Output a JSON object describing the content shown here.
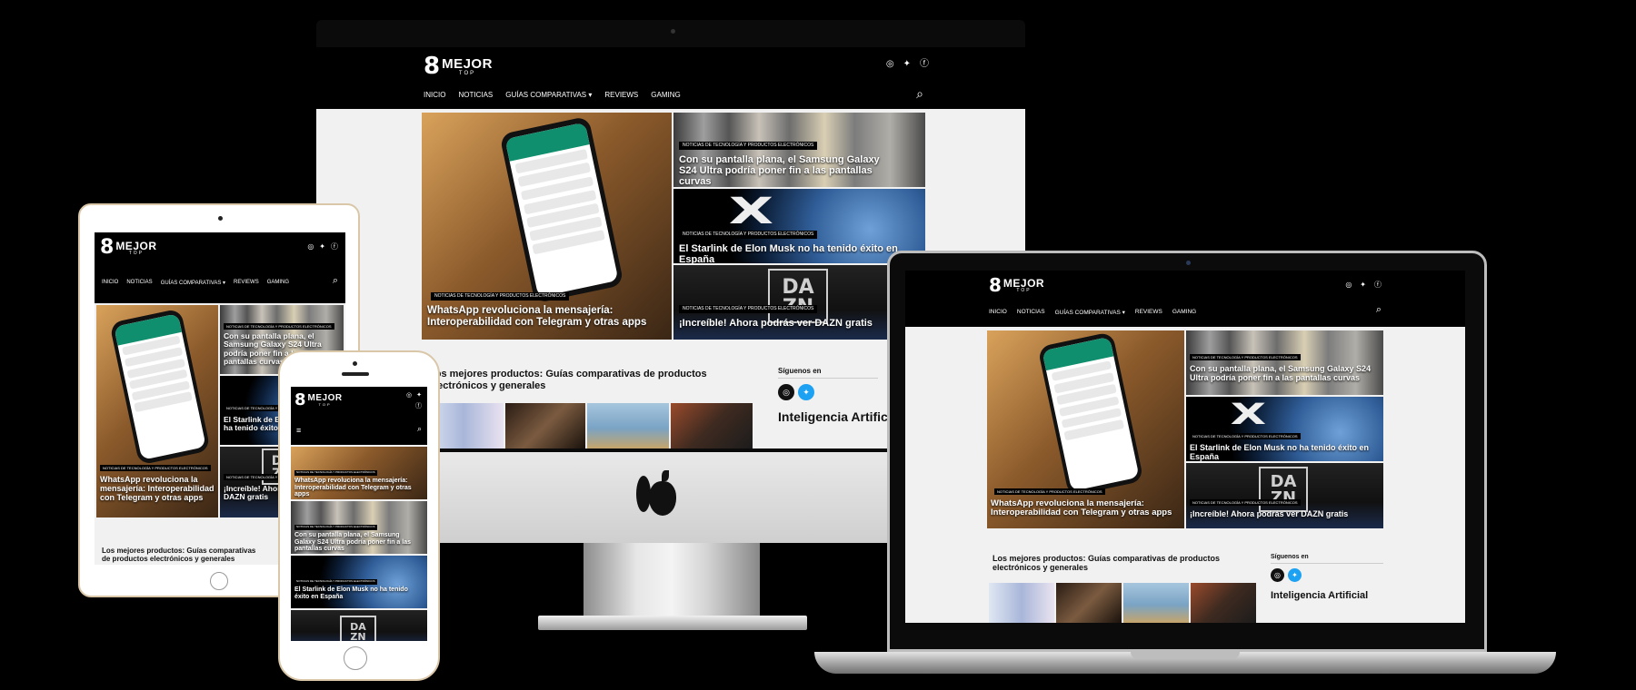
{
  "site": {
    "logo_mark": "8",
    "logo_word": "MEJOR",
    "logo_sub": "TOP",
    "nav": [
      "INICIO",
      "NOTICIAS",
      "GUÍAS COMPARATIVAS ▾",
      "REVIEWS",
      "GAMING"
    ],
    "social_icons": [
      "instagram-icon",
      "twitter-icon",
      "facebook-icon"
    ],
    "social_glyphs": [
      "◎",
      "✦",
      "ⓕ"
    ],
    "search_glyph": "⌕",
    "menu_glyph": "≡",
    "category": "NOTICIAS DE TECNOLOGÍA Y PRODUCTOS ELECTRÓNICOS",
    "articles": [
      {
        "title": "WhatsApp revoluciona la mensajería: Interoperabilidad con Telegram y otras apps"
      },
      {
        "title": "Con su pantalla plana, el Samsung Galaxy S24 Ultra podría poner fin a las pantallas curvas"
      },
      {
        "title": "El Starlink de Elon Musk no ha tenido éxito en España"
      },
      {
        "title": "¡Increíble! Ahora podrás ver DAZN gratis"
      }
    ],
    "section_title": "Los mejores productos: Guías comparativas de productos electrónicos y generales",
    "follow_label": "Síguenos en",
    "widget_title": "Inteligencia Artificial",
    "dazn_text": "DA ZN",
    "starlink_mark": "X"
  },
  "imac": {
    "apple_logo": ""
  },
  "colors": {
    "header": "#000000",
    "page": "#f1f1f1",
    "instagram": "#000000",
    "twitter": "#1da1f2",
    "accent_green": "#0f8f6d"
  }
}
